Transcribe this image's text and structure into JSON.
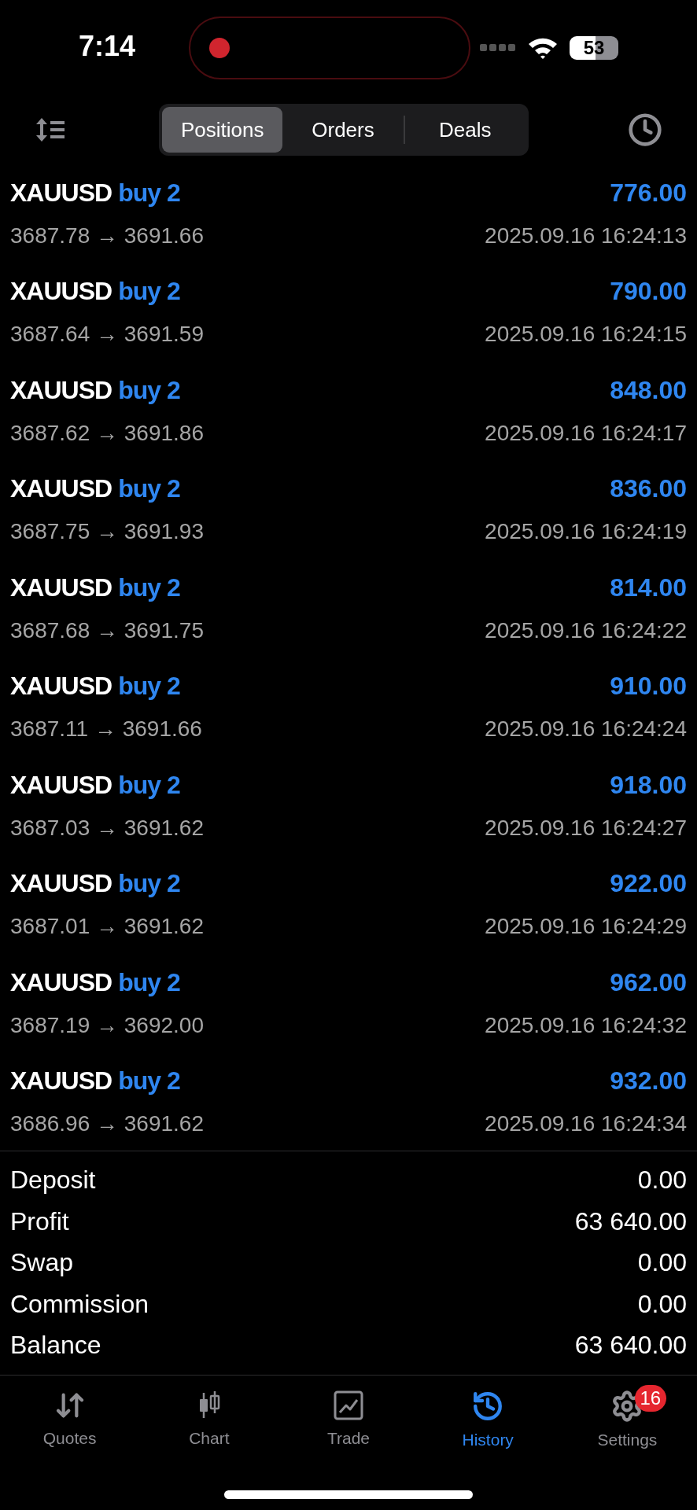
{
  "status_bar": {
    "time": "7:14",
    "battery": "53"
  },
  "tabs": [
    {
      "label": "Positions",
      "selected": true
    },
    {
      "label": "Orders",
      "selected": false
    },
    {
      "label": "Deals",
      "selected": false
    }
  ],
  "positions": [
    {
      "symbol": "XAUUSD",
      "side": "buy 2",
      "profit": "776.00",
      "prices": "3687.78 → 3691.66",
      "time": "2025.09.16 16:24:13"
    },
    {
      "symbol": "XAUUSD",
      "side": "buy 2",
      "profit": "790.00",
      "prices": "3687.64 → 3691.59",
      "time": "2025.09.16 16:24:15"
    },
    {
      "symbol": "XAUUSD",
      "side": "buy 2",
      "profit": "848.00",
      "prices": "3687.62 → 3691.86",
      "time": "2025.09.16 16:24:17"
    },
    {
      "symbol": "XAUUSD",
      "side": "buy 2",
      "profit": "836.00",
      "prices": "3687.75 → 3691.93",
      "time": "2025.09.16 16:24:19"
    },
    {
      "symbol": "XAUUSD",
      "side": "buy 2",
      "profit": "814.00",
      "prices": "3687.68 → 3691.75",
      "time": "2025.09.16 16:24:22"
    },
    {
      "symbol": "XAUUSD",
      "side": "buy 2",
      "profit": "910.00",
      "prices": "3687.11 → 3691.66",
      "time": "2025.09.16 16:24:24"
    },
    {
      "symbol": "XAUUSD",
      "side": "buy 2",
      "profit": "918.00",
      "prices": "3687.03 → 3691.62",
      "time": "2025.09.16 16:24:27"
    },
    {
      "symbol": "XAUUSD",
      "side": "buy 2",
      "profit": "922.00",
      "prices": "3687.01 → 3691.62",
      "time": "2025.09.16 16:24:29"
    },
    {
      "symbol": "XAUUSD",
      "side": "buy 2",
      "profit": "962.00",
      "prices": "3687.19 → 3692.00",
      "time": "2025.09.16 16:24:32"
    },
    {
      "symbol": "XAUUSD",
      "side": "buy 2",
      "profit": "932.00",
      "prices": "3686.96 → 3691.62",
      "time": "2025.09.16 16:24:34"
    }
  ],
  "summary": [
    {
      "label": "Deposit",
      "value": "0.00"
    },
    {
      "label": "Profit",
      "value": "63 640.00"
    },
    {
      "label": "Swap",
      "value": "0.00"
    },
    {
      "label": "Commission",
      "value": "0.00"
    },
    {
      "label": "Balance",
      "value": "63 640.00"
    }
  ],
  "nav": [
    {
      "kind": "quotes",
      "label": "Quotes",
      "selected": false
    },
    {
      "kind": "chart",
      "label": "Chart",
      "selected": false
    },
    {
      "kind": "trade",
      "label": "Trade",
      "selected": false
    },
    {
      "kind": "history",
      "label": "History",
      "selected": true
    },
    {
      "kind": "settings",
      "label": "Settings",
      "selected": false,
      "badge": "16"
    }
  ]
}
